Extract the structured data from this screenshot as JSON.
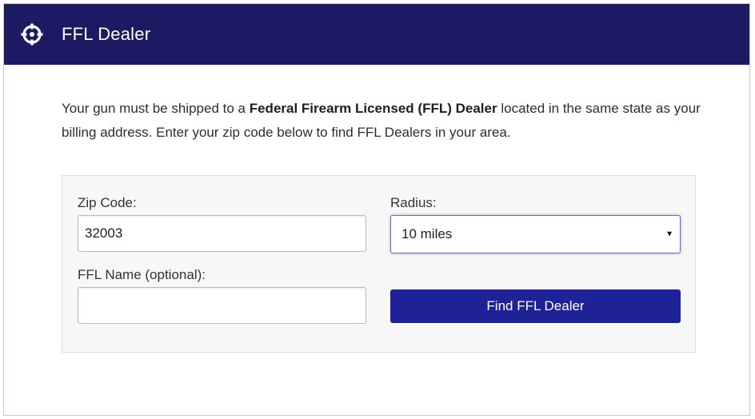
{
  "header": {
    "title": "FFL Dealer",
    "icon": "crosshair-icon",
    "background": "#1b1a63"
  },
  "intro": {
    "text_before": "Your gun must be shipped to a ",
    "bold_text": "Federal Firearm Licensed (FFL) Dealer",
    "text_after": " located in the same state as your billing address. Enter your zip code below to find FFL Dealers in your area."
  },
  "form": {
    "zip": {
      "label": "Zip Code:",
      "value": "32003"
    },
    "radius": {
      "label": "Radius:",
      "selected": "10 miles"
    },
    "ffl_name": {
      "label": "FFL Name (optional):",
      "value": ""
    },
    "submit_label": "Find FFL Dealer",
    "accent": "#1f2296"
  }
}
